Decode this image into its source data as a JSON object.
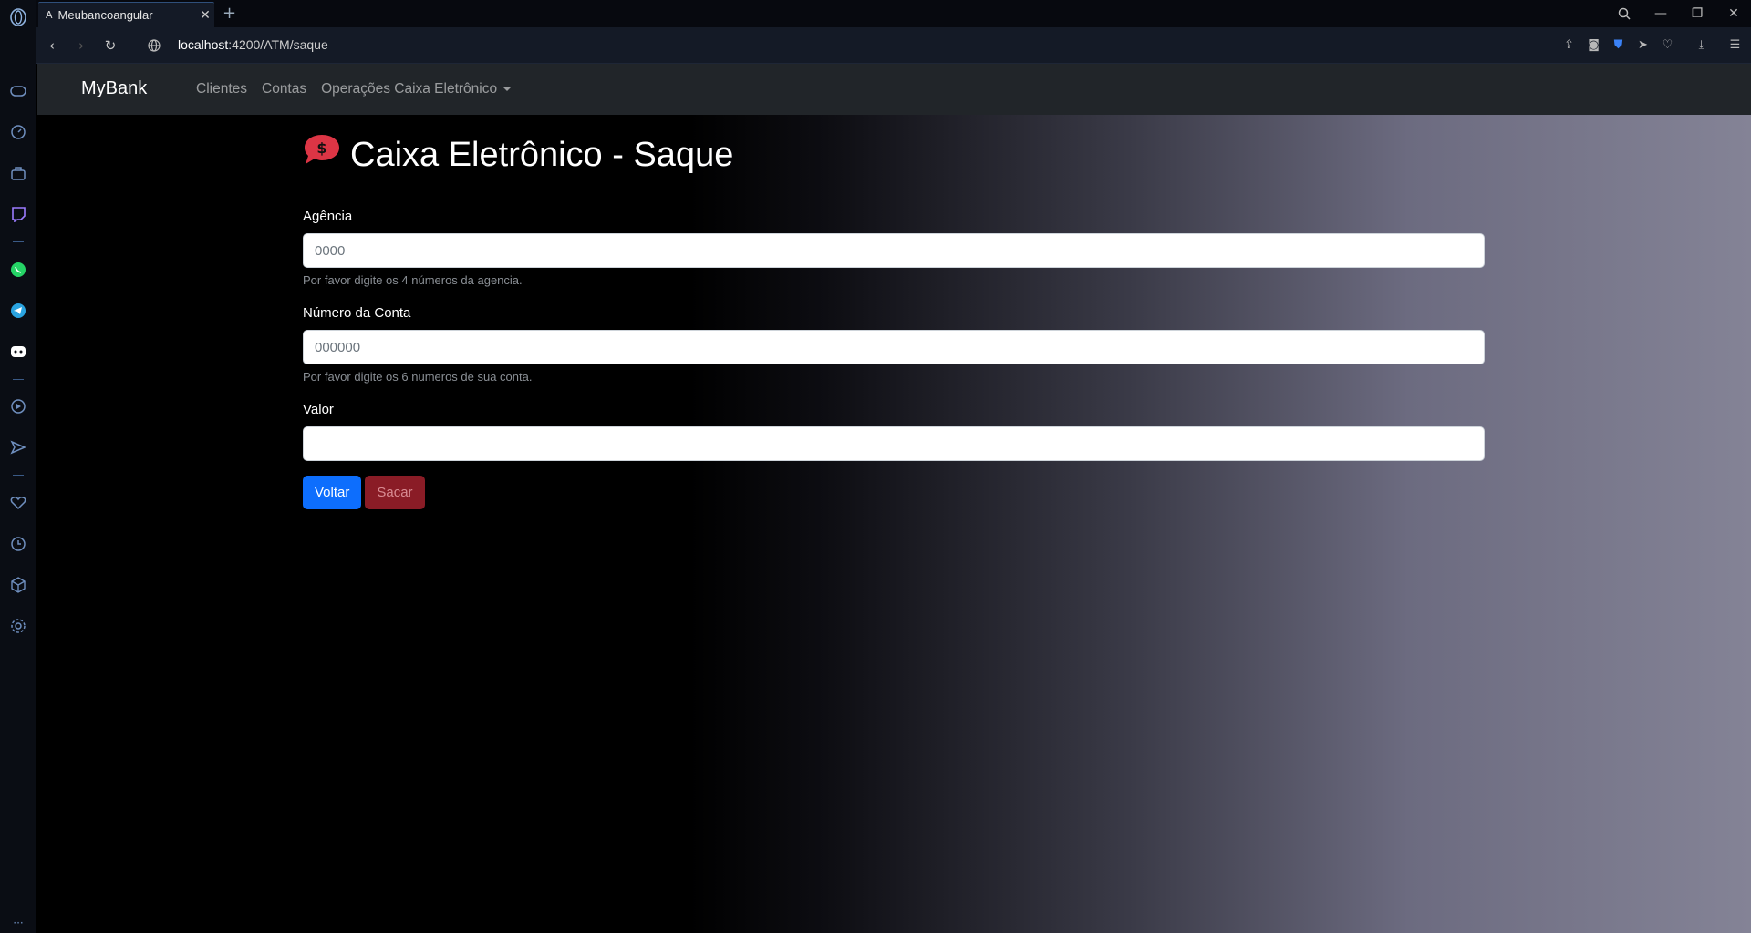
{
  "browser": {
    "tab": {
      "title": "Meubancoangular"
    },
    "url_host": "localhost",
    "url_rest": ":4200/ATM/saque"
  },
  "navbar": {
    "brand": "MyBank",
    "links": [
      {
        "label": "Clientes"
      },
      {
        "label": "Contas"
      },
      {
        "label": "Operações Caixa Eletrônico"
      }
    ]
  },
  "page": {
    "title": "Caixa Eletrônico - Saque",
    "fields": {
      "agencia": {
        "label": "Agência",
        "placeholder": "0000",
        "value": "",
        "help": "Por favor digite os 4 números da agencia."
      },
      "conta": {
        "label": "Número da Conta",
        "placeholder": "000000",
        "value": "",
        "help": "Por favor digite os 6 numeros de sua conta."
      },
      "valor": {
        "label": "Valor",
        "placeholder": "",
        "value": ""
      }
    },
    "buttons": {
      "back": "Voltar",
      "withdraw": "Sacar"
    }
  },
  "colors": {
    "primary": "#0d6efd",
    "danger": "#8a1c26",
    "navbar": "#212529",
    "icon_red": "#dc3545"
  }
}
